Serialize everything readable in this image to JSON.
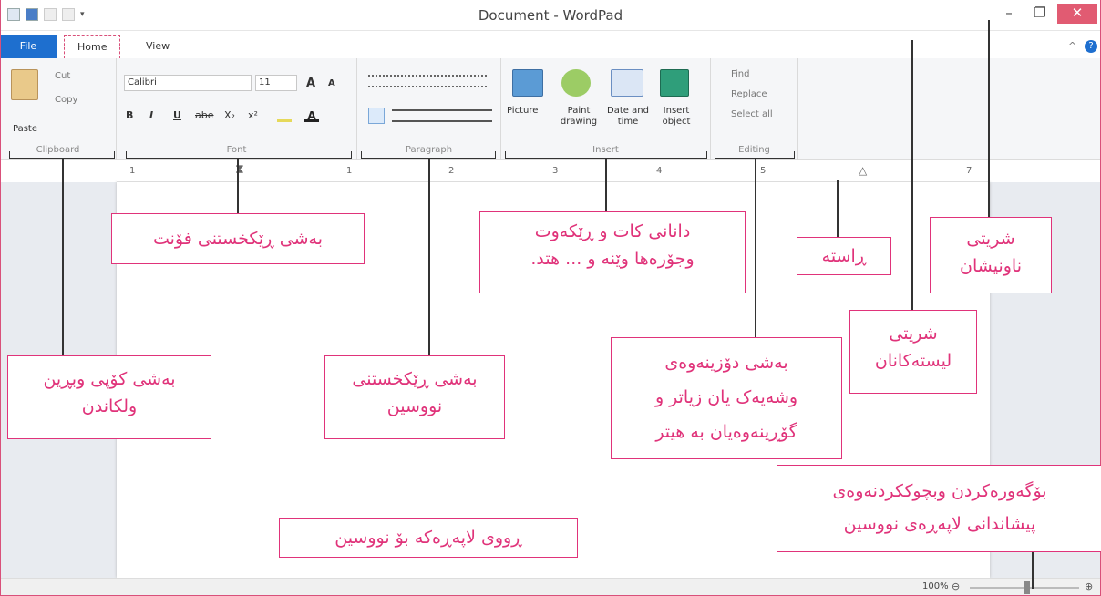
{
  "window": {
    "title": "Document - WordPad",
    "min": "–",
    "max": "❐",
    "close": "✕"
  },
  "tabs": {
    "file": "File",
    "home": "Home",
    "view": "View",
    "help": "?",
    "collapse": "^"
  },
  "clipboard": {
    "paste": "Paste",
    "cut": "Cut",
    "copy": "Copy",
    "label": "Clipboard"
  },
  "font": {
    "name": "Calibri",
    "size": "11",
    "label": "Font",
    "bold": "B",
    "italic": "I",
    "underline": "U",
    "strike": "abe",
    "sub": "X₂",
    "sup": "x²",
    "grow": "A",
    "shrink": "A"
  },
  "paragraph": {
    "label": "Paragraph"
  },
  "insert": {
    "picture": "Picture",
    "paint": "Paint drawing",
    "datetime": "Date and time",
    "object": "Insert object",
    "label": "Insert"
  },
  "editing": {
    "find": "Find",
    "replace": "Replace",
    "selectall": "Select all",
    "label": "Editing"
  },
  "ruler": {
    "n1": "1",
    "n2": "1",
    "n3": "2",
    "n4": "3",
    "n5": "4",
    "n6": "5",
    "n7": "7"
  },
  "status": {
    "zoom": "100%"
  },
  "notes": {
    "font": "بەشی ڕێکخستنی فۆنت",
    "insert_l1": "دانانی کات و ڕێکەوت",
    "insert_l2": "وجۆرەها وێنە و ... هتد.",
    "ruler": "ڕاستە",
    "titlebar_l1": "شریتی",
    "titlebar_l2": "ناونیشان",
    "menu_l1": "شریتی",
    "menu_l2": "لیستەکانان",
    "clipboard_l1": "بەشی کۆپی وبڕین",
    "clipboard_l2": "ولکاندن",
    "paragraph_l1": "بەشی ڕێکخستنی",
    "paragraph_l2": "نووسین",
    "editing_l1": "بەشی دۆزینەوەی",
    "editing_l2": "وشەیەک یان زیاتر و",
    "editing_l3": "گۆڕینەوەیان بە هیتر",
    "zoom_l1": "بۆگەورەکردن وبچوککردنەوەی",
    "zoom_l2": "پیشاندانی لاپەڕەی نووسین",
    "page": "ڕووی لاپەڕەکە بۆ نووسین"
  }
}
